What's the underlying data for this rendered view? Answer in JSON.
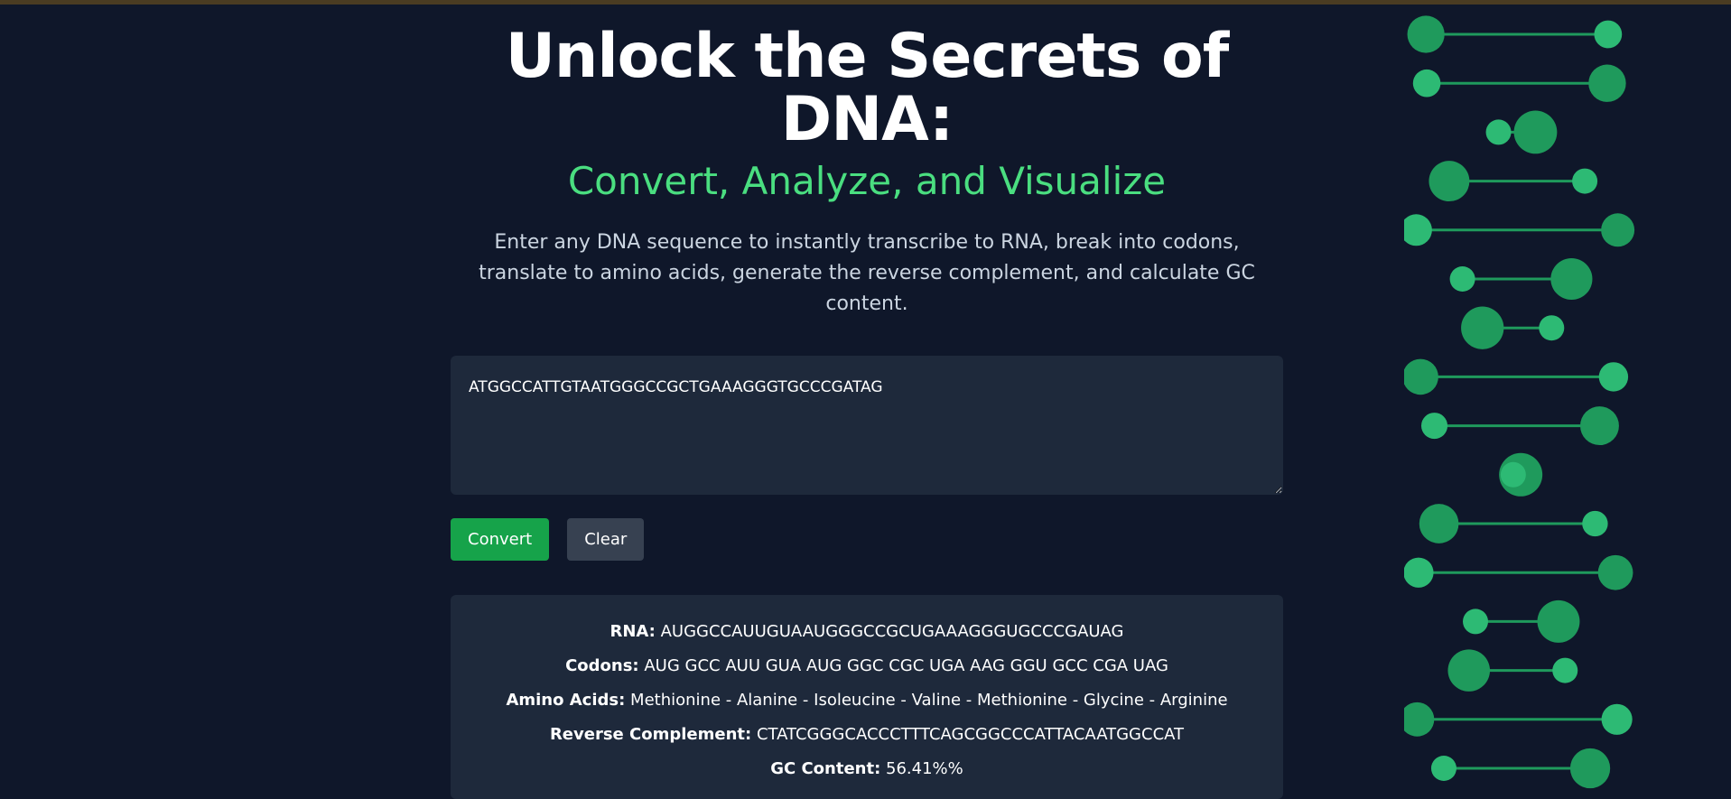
{
  "hero": {
    "title_line1": "Unlock the Secrets of",
    "title_line2": "DNA:",
    "subtitle": "Convert, Analyze, and Visualize",
    "description": "Enter any DNA sequence to instantly transcribe to RNA, break into codons, translate to amino acids, generate the reverse complement, and calculate GC content."
  },
  "input": {
    "value": "ATGGCCATTGTAATGGGCCGCTGAAAGGGTGCCCGATAG"
  },
  "buttons": {
    "convert_label": "Convert",
    "clear_label": "Clear"
  },
  "results": {
    "rna_label": "RNA:",
    "rna_value": "AUGGCCAUUGUAAUGGGCCGCUGAAAGGGUGCCCGAUAG",
    "codons_label": "Codons:",
    "codons_value": "AUG GCC AUU GUA AUG GGC CGC UGA AAG GGU GCC CGA UAG",
    "amino_label": "Amino Acids:",
    "amino_value": "Methionine - Alanine - Isoleucine - Valine - Methionine - Glycine - Arginine",
    "revcomp_label": "Reverse Complement:",
    "revcomp_value": "CTATCGGGCACCCTTTCAGCGGCCCATTACAATGGCCAT",
    "gc_label": "GC Content:",
    "gc_value": "56.41%%"
  },
  "colors": {
    "background": "#0f172a",
    "panel": "#1e293b",
    "accent_green": "#4ade80",
    "button_green": "#16a34a",
    "button_gray": "#374151",
    "helix_light": "#2dba74",
    "helix_dark": "#1f9a5c",
    "helix_bar": "#1f9a5c"
  },
  "decoration": {
    "helix_icon": "dna-double-helix"
  }
}
